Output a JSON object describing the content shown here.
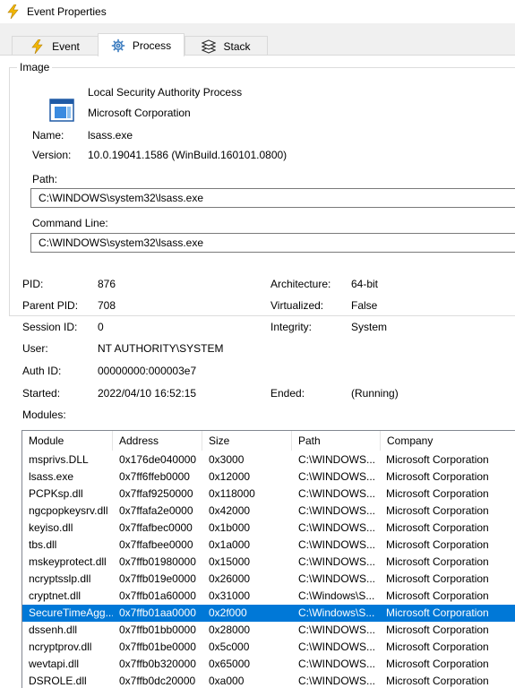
{
  "window": {
    "title": "Event Properties",
    "icon": "lightning-bolt-icon"
  },
  "tabs": [
    {
      "label": "Event",
      "icon": "lightning-bolt-icon"
    },
    {
      "label": "Process",
      "icon": "gear-icon",
      "active": true
    },
    {
      "label": "Stack",
      "icon": "stack-icon"
    }
  ],
  "image": {
    "group_label": "Image",
    "icon": "process-window-icon",
    "description": "Local Security Authority Process",
    "company": "Microsoft Corporation",
    "name_label": "Name:",
    "name": "lsass.exe",
    "version_label": "Version:",
    "version": "10.0.19041.1586 (WinBuild.160101.0800)",
    "path_label": "Path:",
    "path": "C:\\WINDOWS\\system32\\lsass.exe",
    "cmdline_label": "Command Line:",
    "cmdline": "C:\\WINDOWS\\system32\\lsass.exe"
  },
  "info": {
    "pid_label": "PID:",
    "pid": "876",
    "parent_pid_label": "Parent PID:",
    "parent_pid": "708",
    "session_label": "Session ID:",
    "session": "0",
    "user_label": "User:",
    "user": "NT AUTHORITY\\SYSTEM",
    "auth_label": "Auth ID:",
    "auth": "00000000:000003e7",
    "started_label": "Started:",
    "started": "2022/04/10 16:52:15",
    "arch_label": "Architecture:",
    "arch": "64-bit",
    "virt_label": "Virtualized:",
    "virt": "False",
    "integrity_label": "Integrity:",
    "integrity": "System",
    "ended_label": "Ended:",
    "ended": "(Running)",
    "modules_label": "Modules:"
  },
  "modules": {
    "columns": [
      "Module",
      "Address",
      "Size",
      "Path",
      "Company"
    ],
    "rows": [
      [
        "msprivs.DLL",
        "0x176de040000",
        "0x3000",
        "C:\\WINDOWS...",
        "Microsoft Corporation"
      ],
      [
        "lsass.exe",
        "0x7ff6ffeb0000",
        "0x12000",
        "C:\\WINDOWS...",
        "Microsoft Corporation"
      ],
      [
        "PCPKsp.dll",
        "0x7ffaf9250000",
        "0x118000",
        "C:\\WINDOWS...",
        "Microsoft Corporation"
      ],
      [
        "ngcpopkeysrv.dll",
        "0x7ffafa2e0000",
        "0x42000",
        "C:\\WINDOWS...",
        "Microsoft Corporation"
      ],
      [
        "keyiso.dll",
        "0x7ffafbec0000",
        "0x1b000",
        "C:\\WINDOWS...",
        "Microsoft Corporation"
      ],
      [
        "tbs.dll",
        "0x7ffafbee0000",
        "0x1a000",
        "C:\\WINDOWS...",
        "Microsoft Corporation"
      ],
      [
        "mskeyprotect.dll",
        "0x7ffb01980000",
        "0x15000",
        "C:\\WINDOWS...",
        "Microsoft Corporation"
      ],
      [
        "ncryptsslp.dll",
        "0x7ffb019e0000",
        "0x26000",
        "C:\\WINDOWS...",
        "Microsoft Corporation"
      ],
      [
        "cryptnet.dll",
        "0x7ffb01a60000",
        "0x31000",
        "C:\\Windows\\S...",
        "Microsoft Corporation"
      ],
      [
        "SecureTimeAgg...",
        "0x7ffb01aa0000",
        "0x2f000",
        "C:\\Windows\\S...",
        "Microsoft Corporation"
      ],
      [
        "dssenh.dll",
        "0x7ffb01bb0000",
        "0x28000",
        "C:\\WINDOWS...",
        "Microsoft Corporation"
      ],
      [
        "ncryptprov.dll",
        "0x7ffb01be0000",
        "0x5c000",
        "C:\\WINDOWS...",
        "Microsoft Corporation"
      ],
      [
        "wevtapi.dll",
        "0x7ffb0b320000",
        "0x65000",
        "C:\\WINDOWS...",
        "Microsoft Corporation"
      ],
      [
        "DSROLE.dll",
        "0x7ffb0dc20000",
        "0xa000",
        "C:\\WINDOWS...",
        "Microsoft Corporation"
      ]
    ],
    "selected_index": 9
  },
  "colors": {
    "selection": "#0078d7",
    "bolt": "#f2b705",
    "tab_bg": "#f0f0f0"
  }
}
